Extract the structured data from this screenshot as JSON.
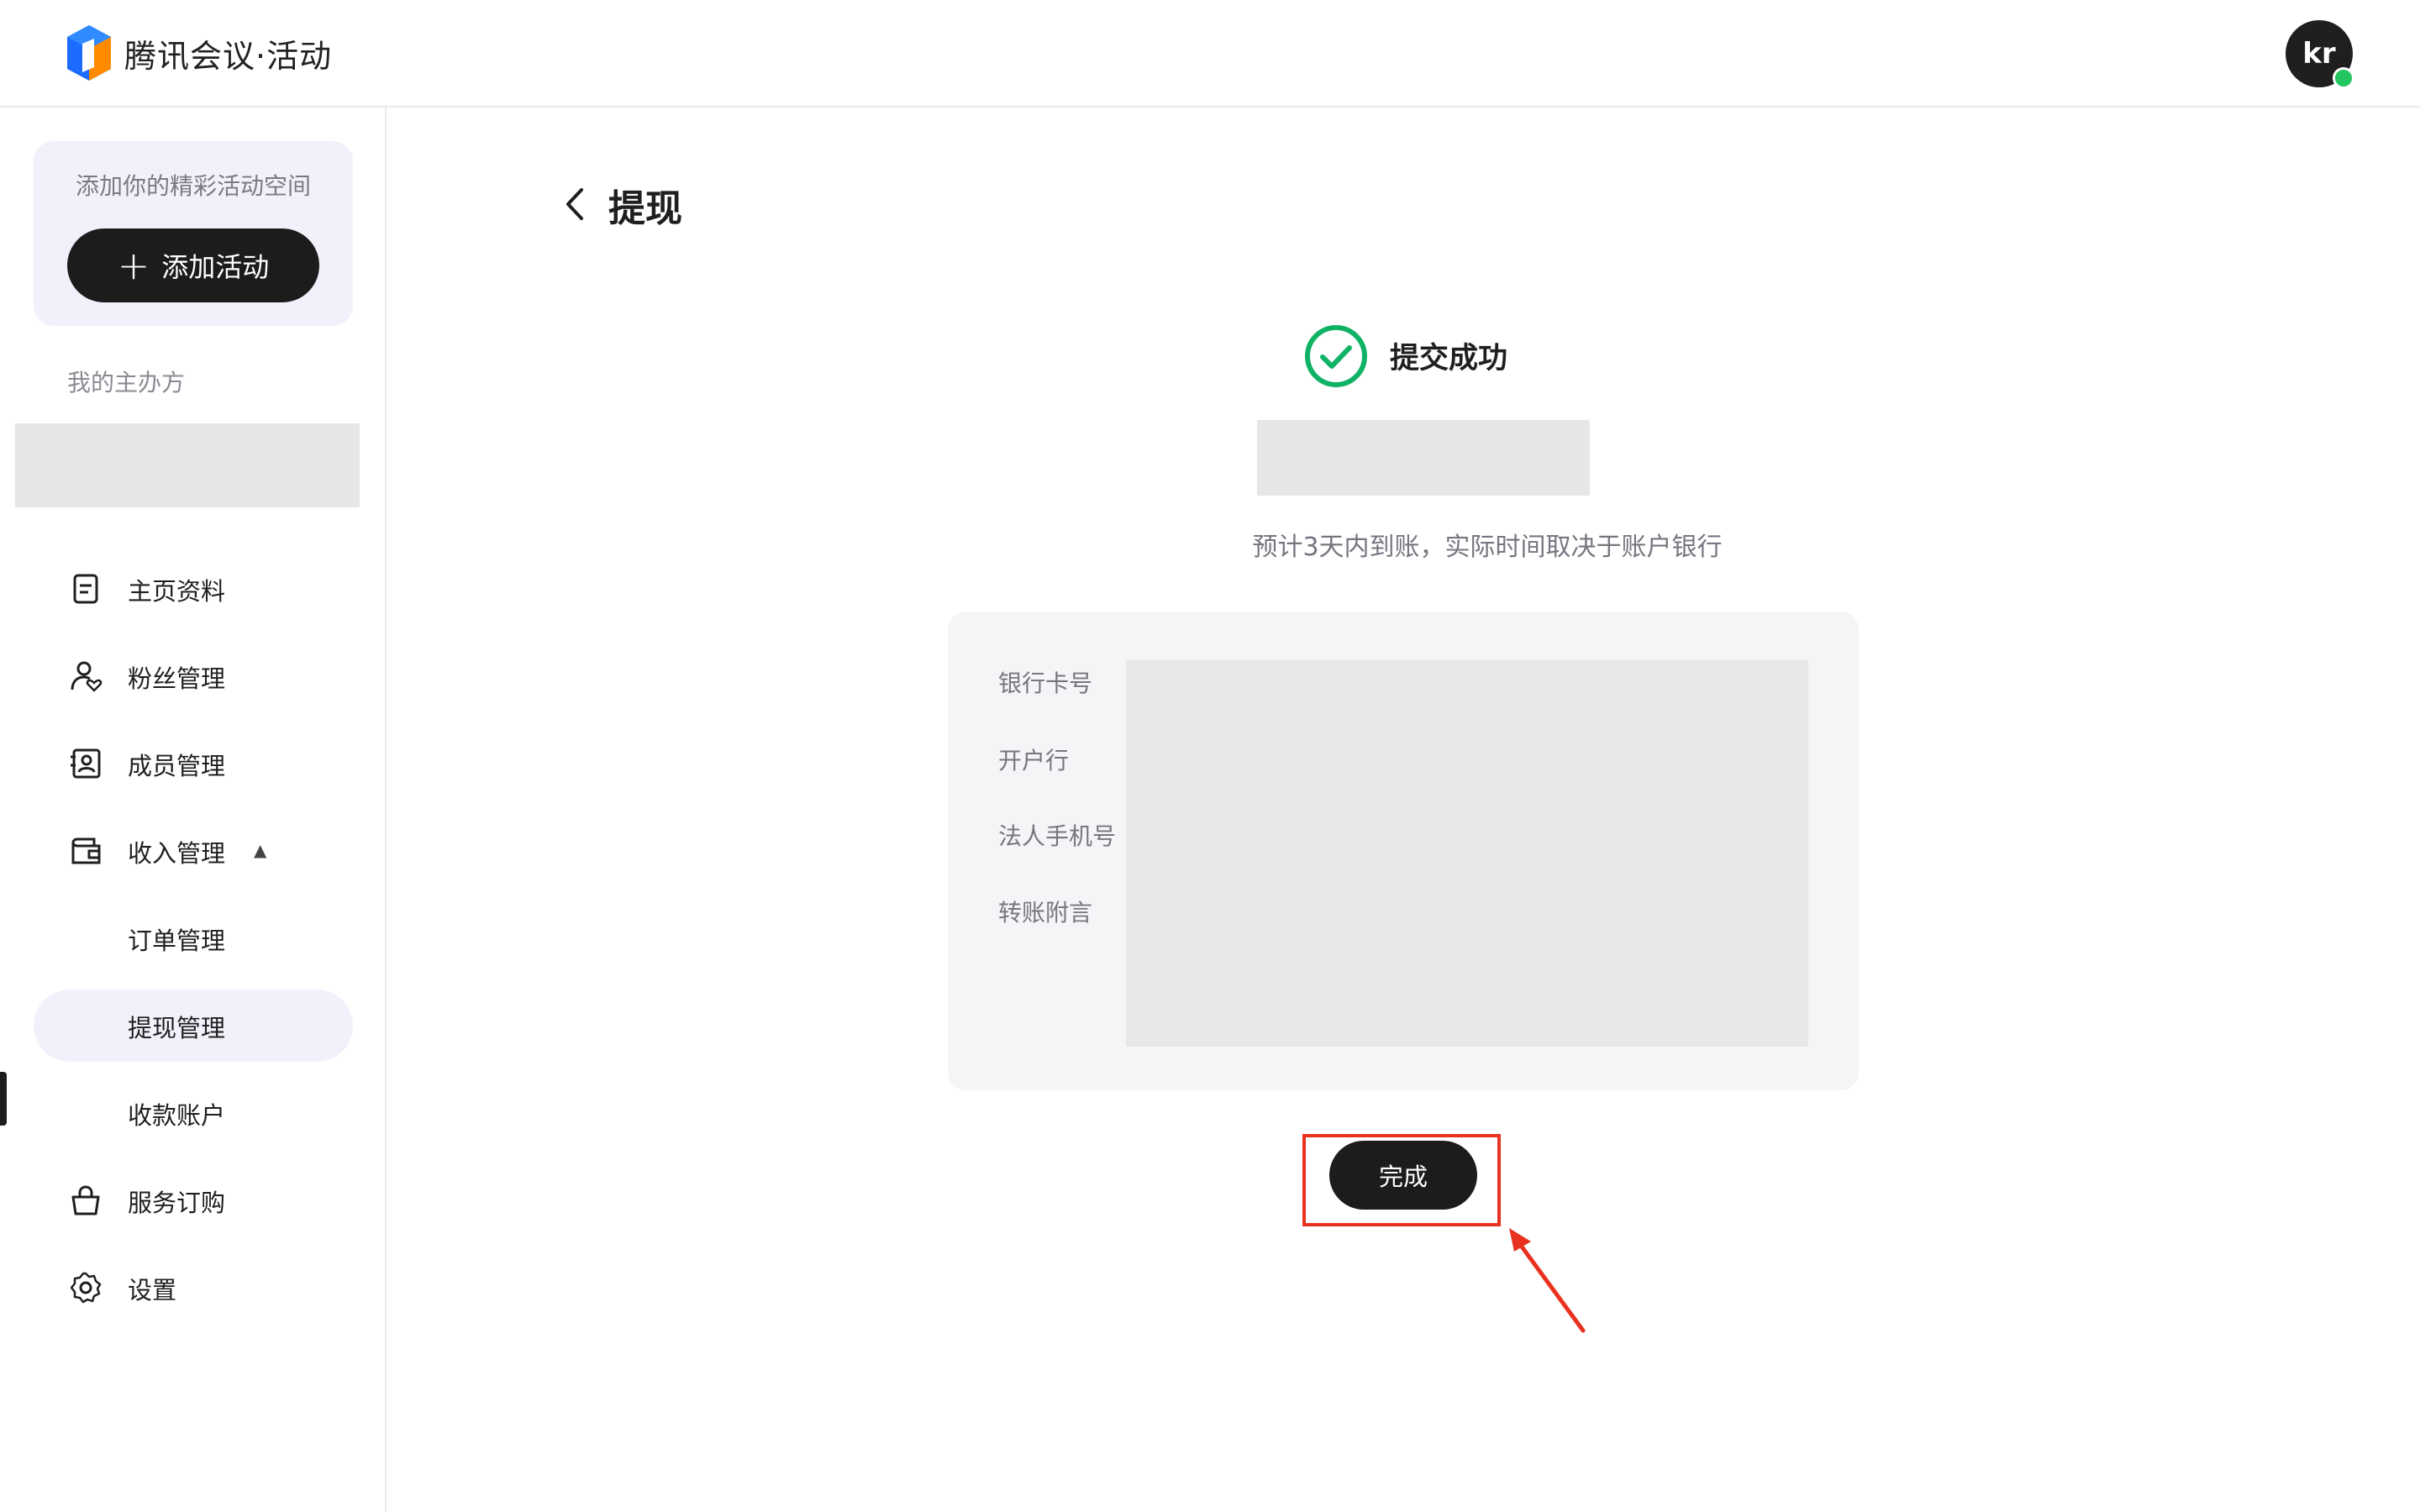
{
  "header": {
    "brand": "腾讯会议·活动",
    "avatar_initials": "kr",
    "logo_icon": "tencent-meeting-cube-logo",
    "online_status_color": "#22c55e"
  },
  "sidebar": {
    "promo_text": "添加你的精彩活动空间",
    "add_activity_label": "添加活动",
    "section_label": "我的主办方",
    "items": [
      {
        "label": "主页资料",
        "icon": "document-icon"
      },
      {
        "label": "粉丝管理",
        "icon": "user-heart-icon"
      },
      {
        "label": "成员管理",
        "icon": "contact-card-icon"
      },
      {
        "label": "收入管理",
        "icon": "wallet-icon",
        "expanded": true
      },
      {
        "label": "订单管理"
      },
      {
        "label": "提现管理",
        "active": true
      },
      {
        "label": "收款账户"
      },
      {
        "label": "服务订购",
        "icon": "shopping-bag-icon"
      },
      {
        "label": "设置",
        "icon": "gear-icon"
      }
    ]
  },
  "main": {
    "title": "提现",
    "success_text": "提交成功",
    "note": "预计3天内到账，实际时间取决于账户银行",
    "fields": [
      {
        "label": "银行卡号"
      },
      {
        "label": "开户行"
      },
      {
        "label": "法人手机号"
      },
      {
        "label": "转账附言"
      }
    ],
    "done_label": "完成",
    "success_color": "#10b365",
    "annotation_color": "#e8321f"
  }
}
